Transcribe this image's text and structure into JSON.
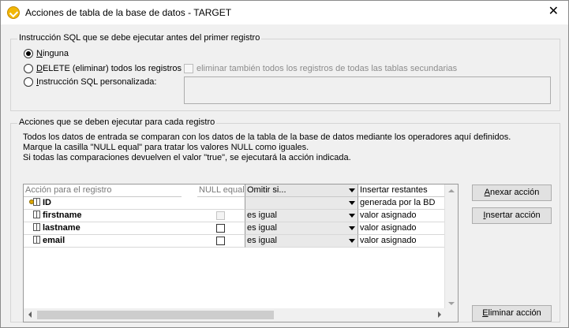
{
  "window": {
    "title": "Acciones de tabla de la base de datos - TARGET"
  },
  "pre_group": {
    "legend": "Instrucción SQL que se debe ejecutar antes del primer registro",
    "option_none": {
      "mnemonic": "N",
      "rest": "inguna",
      "selected": true
    },
    "option_delete": {
      "mnemonic": "D",
      "rest": "ELETE (eliminar) todos los registros",
      "selected": false
    },
    "option_custom": {
      "mnemonic": "I",
      "rest": "nstrucción SQL personalizada:",
      "selected": false
    },
    "also_delete_label": "eliminar también todos los registros de todas las tablas secundarias",
    "custom_sql_value": ""
  },
  "actions_group": {
    "legend": "Acciones que se deben ejecutar para cada registro",
    "desc1": "Todos los datos de entrada se comparan con los datos de la tabla de la base de datos mediante los operadores aquí definidos.",
    "desc2": "Marque la casilla \"NULL equal\" para tratar los valores NULL como iguales.",
    "desc3": "Si todas las comparaciones devuelven el valor \"true\", se ejecutará la acción indicada."
  },
  "grid": {
    "headers": {
      "field": "Acción para el registro",
      "null_equal": "NULL equal",
      "omit": "Omitir si...",
      "insert": "Insertar restantes"
    },
    "rows": [
      {
        "name": "ID",
        "key": true,
        "null_checkbox": false,
        "operator": "",
        "value": "generada por la BD"
      },
      {
        "name": "firstname",
        "key": false,
        "null_checkbox": true,
        "null_enabled": false,
        "operator": "es igual",
        "value": "valor asignado"
      },
      {
        "name": "lastname",
        "key": false,
        "null_checkbox": true,
        "null_enabled": true,
        "operator": "es igual",
        "value": "valor asignado"
      },
      {
        "name": "email",
        "key": false,
        "null_checkbox": true,
        "null_enabled": true,
        "operator": "es igual",
        "value": "valor asignado"
      }
    ]
  },
  "buttons": {
    "append": {
      "mnemonic": "A",
      "rest": "nexar acción"
    },
    "insert": {
      "mnemonic": "I",
      "rest": "nsertar acción"
    },
    "delete": {
      "mnemonic": "E",
      "rest": "liminar acción"
    }
  }
}
